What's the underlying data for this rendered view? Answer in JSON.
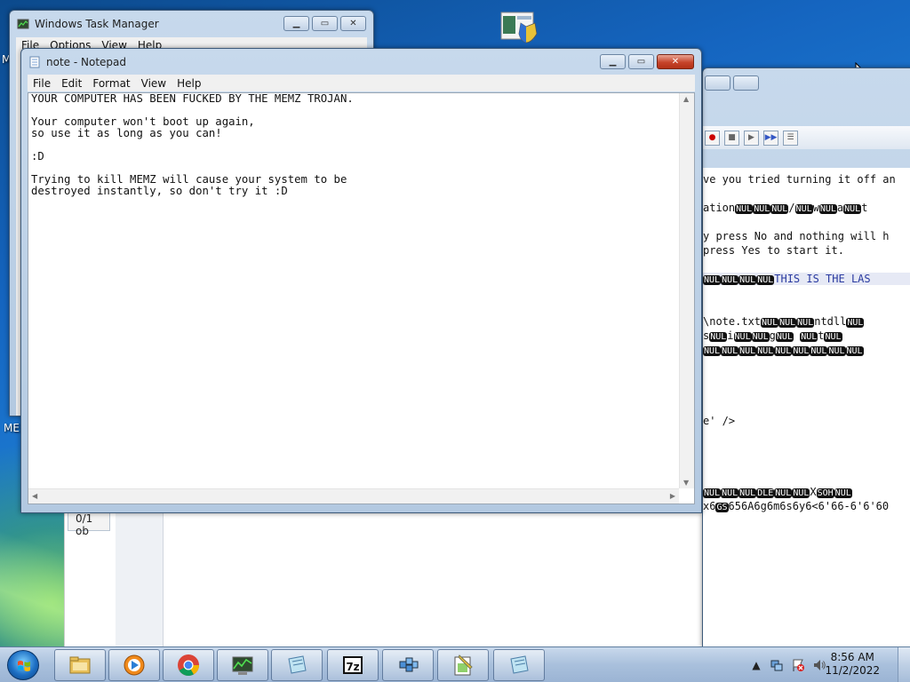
{
  "desktop": {
    "left_labels": [
      "M",
      "MEM"
    ]
  },
  "task_manager": {
    "title": "Windows Task Manager",
    "menu": [
      "File",
      "Options",
      "View",
      "Help"
    ]
  },
  "hex_editor": {
    "lines": [
      {
        "text": "ve you tried turning it off an",
        "highlight": false
      },
      {
        "text": "ation␀␀␀/␀w␀a␀t",
        "highlight": false
      },
      {
        "text": "y press No and nothing will h",
        "highlight": false
      },
      {
        "text": " press Yes to start it.",
        "highlight": false
      },
      {
        "text": "␀␀␀␀THIS IS THE LAS",
        "highlight": true
      },
      {
        "text": "\\note.txt␀␀␀ntdll␀",
        "highlight": false
      },
      {
        "text": "s␀i␀␀g␀ ␀t␀",
        "highlight": false
      },
      {
        "text": "␀␀␀␀␀␀␀␀␀",
        "highlight": false
      },
      {
        "text": "e' />",
        "highlight": false
      },
      {
        "text": "␀␀␀DLE␀␀XSOH␀",
        "highlight": false
      },
      {
        "text": "x6GS656A6g6m6s6y6<6'66-6'6'60",
        "highlight": false
      }
    ]
  },
  "status_box": "0/1 ob",
  "notepad": {
    "title": "note - Notepad",
    "menu": [
      "File",
      "Edit",
      "Format",
      "View",
      "Help"
    ],
    "content": "YOUR COMPUTER HAS BEEN FUCKED BY THE MEMZ TROJAN.\n\nYour computer won't boot up again,\nso use it as long as you can!\n\n:D\n\nTrying to kill MEMZ will cause your system to be\ndestroyed instantly, so don't try it :D"
  },
  "taskbar": {
    "items": [
      "explorer",
      "media-player",
      "chrome",
      "task-manager",
      "notepad",
      "7zip",
      "registry-editor",
      "notepad-plus",
      "notepad-2"
    ],
    "clock_time": "8:56 AM",
    "clock_date": "11/2/2022"
  }
}
